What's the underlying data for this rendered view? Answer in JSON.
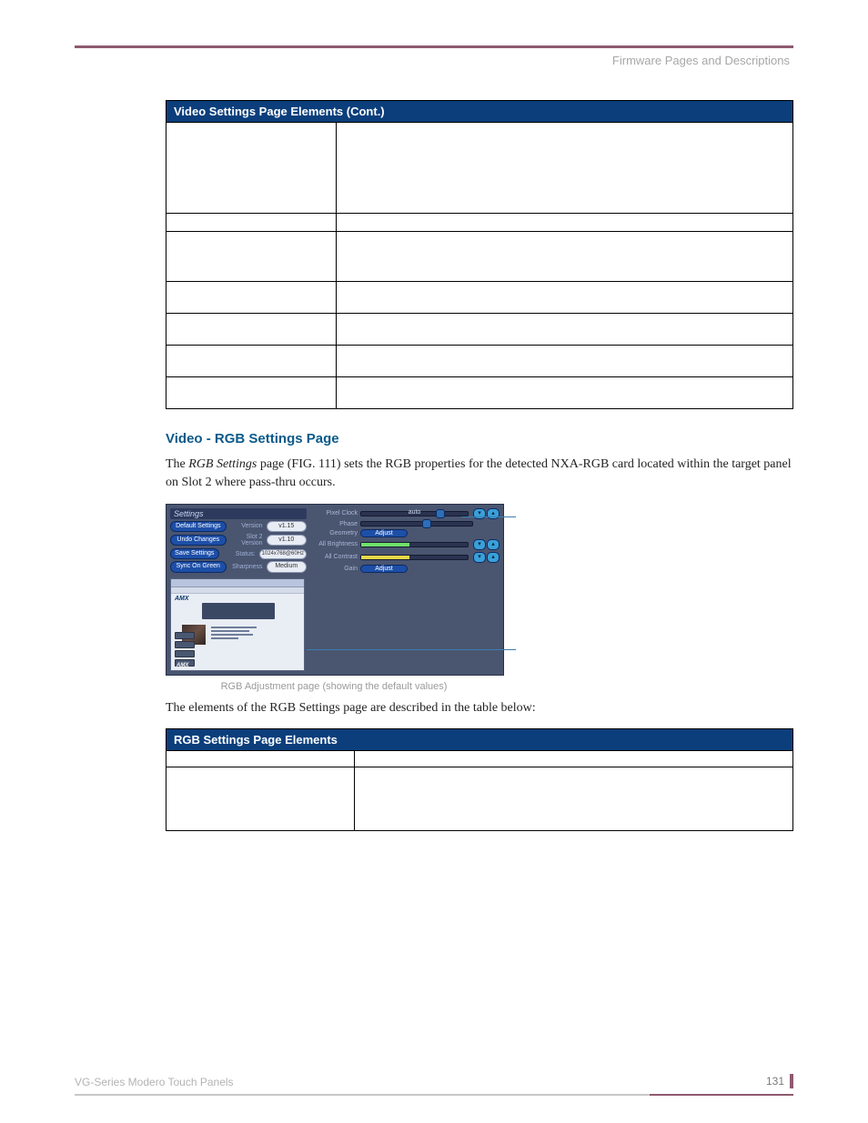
{
  "header": {
    "breadcrumb": "Firmware Pages and Descriptions"
  },
  "table1": {
    "title": "Video Settings Page Elements (Cont.)"
  },
  "section": {
    "heading": "Video - RGB Settings Page",
    "p1_a": "The ",
    "p1_b": "RGB Settings",
    "p1_c": " page (FIG. 111) sets the RGB properties for the detected NXA-RGB card located within the target panel on Slot 2 where pass-thru occurs.",
    "p2": "The elements of the RGB Settings page are described in the table below:"
  },
  "figure": {
    "caption": "RGB Adjustment page (showing the default values)",
    "labels": {
      "settings": "Settings",
      "version_line": "Version",
      "v115": "v1.15",
      "slot_version": "Slot 2 Version",
      "v110": "v1.10",
      "status": "Status:",
      "status_val": "1024x768@60Hz",
      "default_settings": "Default Settings",
      "undo_changes": "Undo Changes",
      "save_settings": "Save Settings",
      "sync_on_green": "Sync On Green",
      "sharpness": "Sharpness",
      "medium": "Medium",
      "pixel_clock": "Pixel Clock",
      "phase": "Phase",
      "geometry": "Geometry",
      "all_brightness": "All Brightness",
      "all_contrast": "All Contrast",
      "gain": "Gain",
      "adjust": "Adjust",
      "auto": "auto",
      "amx": "AMX"
    }
  },
  "table2": {
    "title": "RGB Settings Page Elements"
  },
  "footer": {
    "product": "VG-Series Modero Touch Panels",
    "page": "131"
  }
}
